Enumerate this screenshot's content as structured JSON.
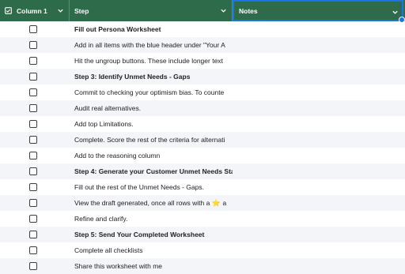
{
  "header": {
    "column1": "Column 1",
    "step": "Step",
    "notes": "Notes"
  },
  "rows": [
    {
      "text": "Fill out Persona Worksheet",
      "bold": true
    },
    {
      "text": "Add in all items with the blue header under \"Your A",
      "bold": false
    },
    {
      "text": "Hit the ungroup buttons. These include longer text",
      "bold": false
    },
    {
      "text": "Step 3: Identify Unmet Needs - Gaps",
      "bold": true
    },
    {
      "text": "Commit to checking your optimism bias. To counte",
      "bold": false
    },
    {
      "text": "Audit real alternatives.",
      "bold": false
    },
    {
      "text": "Add top Limitations.",
      "bold": false
    },
    {
      "text": "Complete. Score the rest of the criteria for alternati",
      "bold": false
    },
    {
      "text": "Add to the reasoning column",
      "bold": false
    },
    {
      "text": "Step 4: Generate your Customer Unmet Needs Sta",
      "bold": true
    },
    {
      "text": "Fill out the rest of the Unmet Needs - Gaps.",
      "bold": false
    },
    {
      "text": "View the draft generated, once all rows with a",
      "suffix": " a",
      "bold": false,
      "icon": "star-icon"
    },
    {
      "text": "Refine and clarify.",
      "bold": false
    },
    {
      "text": "Step 5: Send Your Completed Worksheet",
      "bold": true
    },
    {
      "text": "Complete all checklists",
      "bold": false
    },
    {
      "text": "Share this worksheet with me",
      "bold": false
    }
  ],
  "colors": {
    "header_bg": "#2e6b4a",
    "selection": "#1a73e8",
    "row_alt": "#f3f5f8"
  }
}
